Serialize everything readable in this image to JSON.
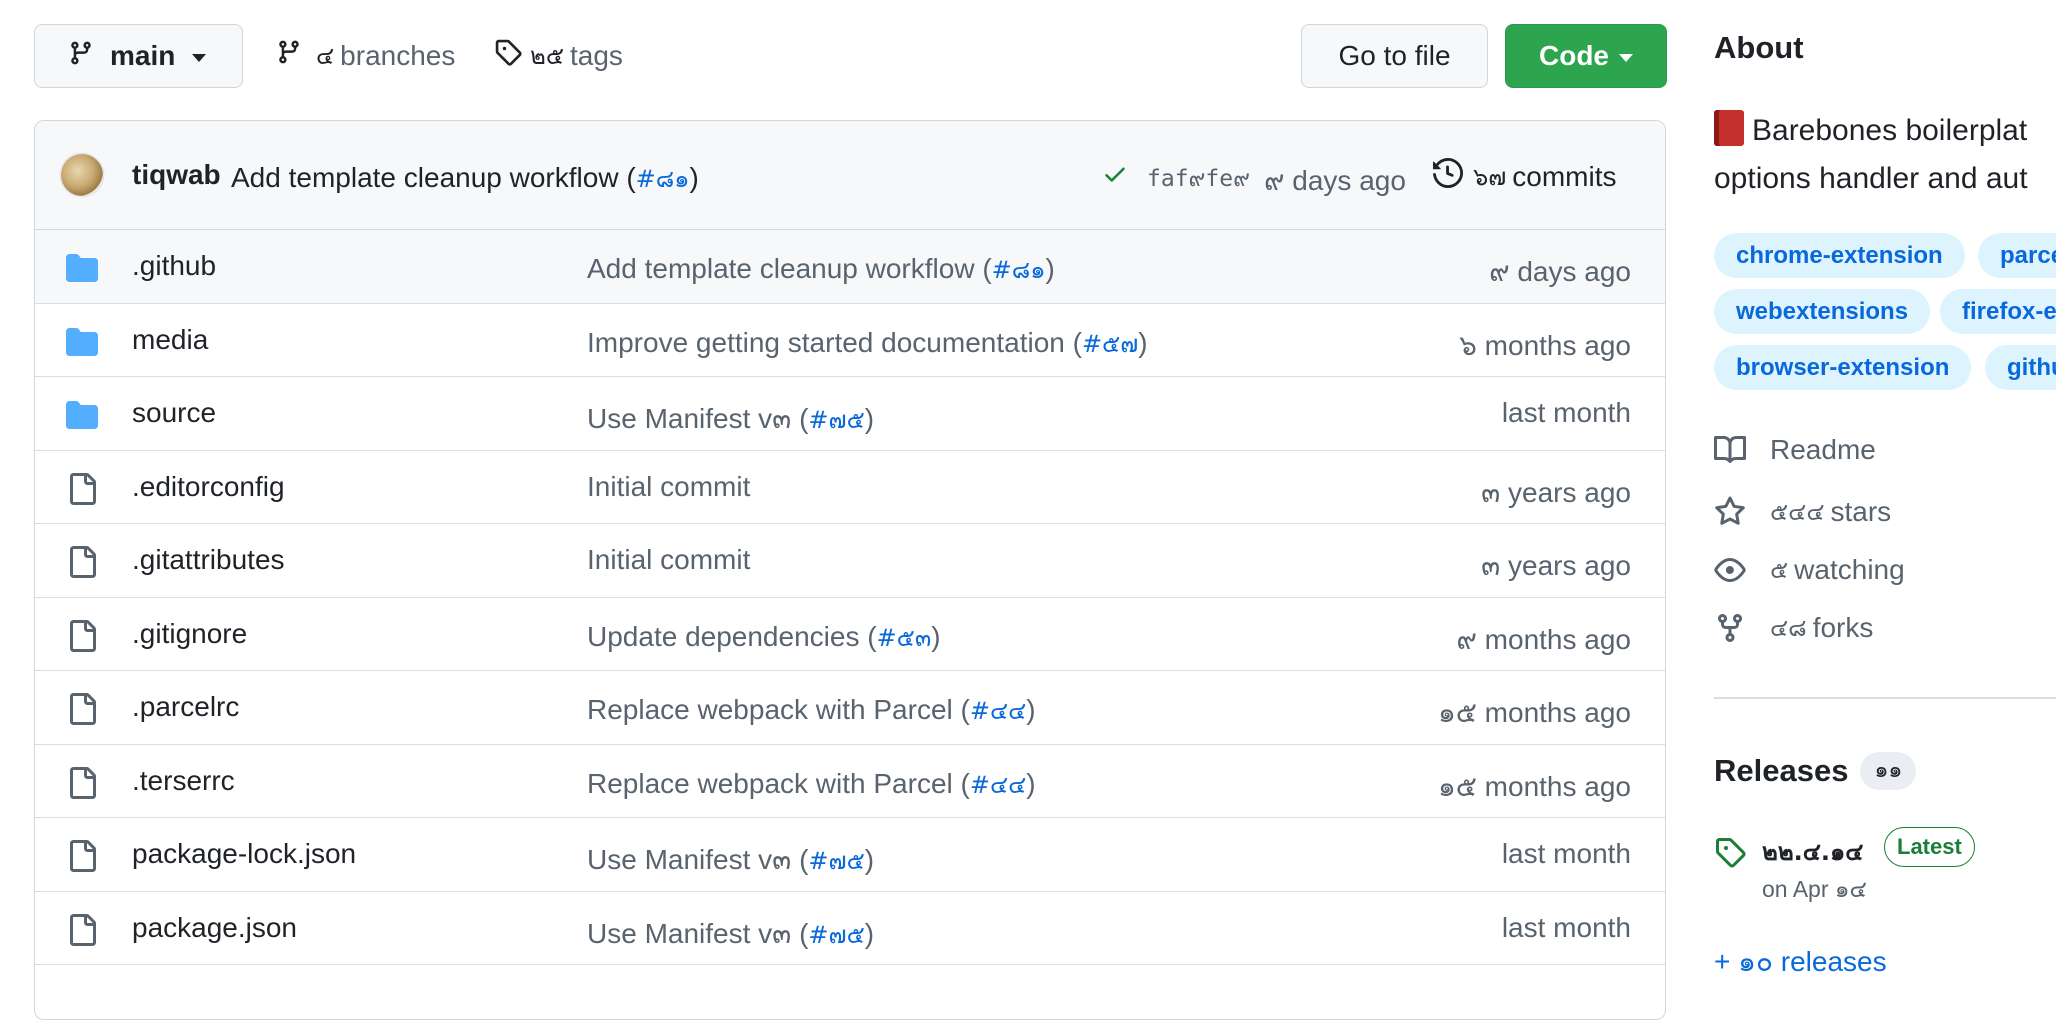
{
  "toolbar": {
    "branch_name": "main",
    "branches_count": "๔",
    "branches_label": "branches",
    "tags_count": "๒๕",
    "tags_label": "tags",
    "goto_file_label": "Go to file",
    "code_label": "Code"
  },
  "latest_commit": {
    "author": "tiqwab",
    "message": "Add template cleanup workflow (",
    "pr": "#๘๑",
    "message_end": ")",
    "sha": "faf๙fe๙",
    "age": "๙ days ago",
    "commits_count": "๖๗",
    "commits_label": "commits"
  },
  "files": [
    {
      "name": ".github",
      "type": "folder",
      "msg": "Add template cleanup workflow (",
      "pr": "#๘๑",
      "msg_end": ")",
      "age": "๙ days ago"
    },
    {
      "name": "media",
      "type": "folder",
      "msg": "Improve getting started documentation (",
      "pr": "#๕๗",
      "msg_end": ")",
      "age": "๖ months ago"
    },
    {
      "name": "source",
      "type": "folder",
      "msg": "Use Manifest v๓ (",
      "pr": "#๗๕",
      "msg_end": ")",
      "age": "last month"
    },
    {
      "name": ".editorconfig",
      "type": "file",
      "msg": "Initial commit",
      "pr": "",
      "msg_end": "",
      "age": "๓ years ago"
    },
    {
      "name": ".gitattributes",
      "type": "file",
      "msg": "Initial commit",
      "pr": "",
      "msg_end": "",
      "age": "๓ years ago"
    },
    {
      "name": ".gitignore",
      "type": "file",
      "msg": "Update dependencies (",
      "pr": "#๕๓",
      "msg_end": ")",
      "age": "๙ months ago"
    },
    {
      "name": ".parcelrc",
      "type": "file",
      "msg": "Replace webpack with Parcel (",
      "pr": "#๔๔",
      "msg_end": ")",
      "age": "๑๕ months ago"
    },
    {
      "name": ".terserrc",
      "type": "file",
      "msg": "Replace webpack with Parcel (",
      "pr": "#๔๔",
      "msg_end": ")",
      "age": "๑๕ months ago"
    },
    {
      "name": "package-lock.json",
      "type": "file",
      "msg": "Use Manifest v๓ (",
      "pr": "#๗๕",
      "msg_end": ")",
      "age": "last month"
    },
    {
      "name": "package.json",
      "type": "file",
      "msg": "Use Manifest v๓ (",
      "pr": "#๗๕",
      "msg_end": ")",
      "age": "last month"
    }
  ],
  "about": {
    "title": "About",
    "description_line1": "Barebones boilerplat",
    "description_line2": "options handler and aut",
    "topics": [
      "chrome-extension",
      "parce",
      "webextensions",
      "firefox-e",
      "browser-extension",
      "githu"
    ]
  },
  "stats": {
    "readme_label": "Readme",
    "stars_count": "๕๔๔",
    "stars_label": "stars",
    "watching_count": "๕",
    "watching_label": "watching",
    "forks_count": "๔๘",
    "forks_label": "forks"
  },
  "releases": {
    "title": "Releases",
    "count": "๑๑",
    "latest_version": "๒๒.๔.๑๔",
    "latest_badge": "Latest",
    "latest_date": "on Apr ๑๔",
    "more_label": "+ ๑๐ releases"
  },
  "colors": {
    "accent": "#0969da",
    "code_button": "#2da44e",
    "folder": "#54aeff",
    "success": "#1a7f37"
  }
}
